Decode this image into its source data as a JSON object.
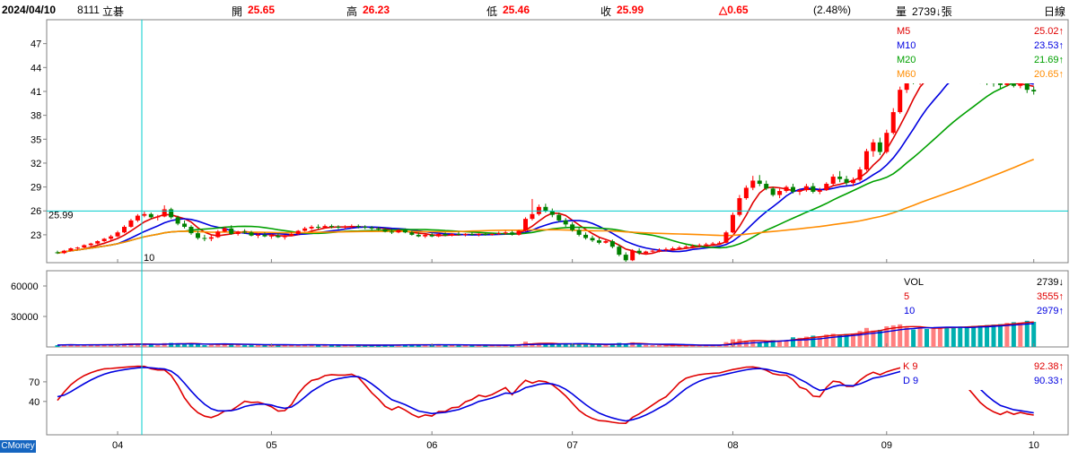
{
  "header": {
    "date": "2024/04/10",
    "code": "8111",
    "name": "立碁",
    "open_label": "開",
    "open": "25.65",
    "high_label": "高",
    "high": "26.23",
    "low_label": "低",
    "low": "25.46",
    "close_label": "收",
    "close": "25.99",
    "change": "△0.65",
    "change_pct": "(2.48%)",
    "volume_label": "量",
    "volume": "2739↓張",
    "period": "日線"
  },
  "colors": {
    "up": "#ff0000",
    "down": "#008000",
    "m5": "#e00000",
    "m10": "#0000e0",
    "m20": "#00a000",
    "m60": "#ff8c00",
    "crosshair": "#00cccc",
    "brand_bg": "#1565c0"
  },
  "brand": "CMoney",
  "chart_data": [
    {
      "type": "candlestick",
      "panel": "price",
      "yticks": [
        23,
        26,
        29,
        32,
        35,
        38,
        41,
        44,
        47
      ],
      "ylim": [
        19.5,
        50
      ],
      "crosshair_value": "25.99",
      "crosshair_tick": "10",
      "x_month_labels": [
        "04",
        "05",
        "06",
        "07",
        "08",
        "09",
        "10"
      ],
      "x_month_index": [
        9,
        32,
        56,
        77,
        101,
        124,
        146
      ],
      "legend": [
        {
          "name": "M5",
          "value": "25.02↑",
          "color": "#e00000"
        },
        {
          "name": "M10",
          "value": "23.53↑",
          "color": "#0000e0"
        },
        {
          "name": "M20",
          "value": "21.69↑",
          "color": "#00a000"
        },
        {
          "name": "M60",
          "value": "20.65↑",
          "color": "#ff8c00"
        }
      ],
      "ohlc": [
        [
          20.8,
          21.0,
          20.6,
          20.7
        ],
        [
          20.7,
          21.1,
          20.6,
          21.0
        ],
        [
          21.0,
          21.4,
          20.9,
          21.3
        ],
        [
          21.3,
          21.5,
          21.1,
          21.4
        ],
        [
          21.4,
          21.8,
          21.3,
          21.7
        ],
        [
          21.7,
          22.0,
          21.5,
          21.9
        ],
        [
          21.9,
          22.3,
          21.8,
          22.2
        ],
        [
          22.2,
          22.6,
          22.1,
          22.5
        ],
        [
          22.5,
          23.0,
          22.3,
          22.8
        ],
        [
          22.8,
          23.5,
          22.7,
          23.3
        ],
        [
          23.3,
          24.2,
          23.2,
          24.0
        ],
        [
          24.0,
          25.0,
          23.9,
          24.8
        ],
        [
          24.8,
          25.6,
          24.6,
          25.4
        ],
        [
          25.4,
          25.9,
          25.2,
          25.6
        ],
        [
          25.6,
          25.8,
          25.0,
          25.2
        ],
        [
          25.2,
          25.5,
          24.8,
          25.3
        ],
        [
          25.3,
          26.7,
          25.2,
          26.2
        ],
        [
          26.2,
          26.4,
          25.0,
          25.2
        ],
        [
          25.2,
          25.4,
          24.2,
          24.4
        ],
        [
          24.4,
          24.8,
          23.8,
          24.0
        ],
        [
          24.0,
          24.2,
          23.0,
          23.2
        ],
        [
          23.2,
          23.5,
          22.4,
          22.6
        ],
        [
          22.6,
          23.0,
          22.2,
          22.5
        ],
        [
          22.5,
          23.0,
          22.2,
          22.7
        ],
        [
          22.7,
          23.6,
          22.6,
          23.4
        ],
        [
          23.4,
          24.0,
          23.3,
          23.8
        ],
        [
          23.8,
          24.2,
          23.0,
          23.1
        ],
        [
          23.1,
          23.5,
          22.9,
          23.4
        ],
        [
          23.4,
          23.7,
          23.1,
          23.3
        ],
        [
          23.3,
          23.5,
          22.8,
          22.9
        ],
        [
          22.9,
          23.2,
          22.6,
          23.0
        ],
        [
          23.0,
          23.3,
          22.7,
          22.8
        ],
        [
          22.8,
          23.1,
          22.5,
          22.9
        ],
        [
          22.9,
          23.2,
          22.6,
          22.7
        ],
        [
          22.7,
          23.0,
          22.4,
          22.9
        ],
        [
          22.9,
          23.3,
          22.8,
          23.1
        ],
        [
          23.1,
          23.6,
          23.0,
          23.5
        ],
        [
          23.5,
          24.0,
          23.4,
          23.8
        ],
        [
          23.8,
          24.2,
          23.6,
          24.0
        ],
        [
          24.0,
          24.3,
          23.7,
          23.9
        ],
        [
          23.9,
          24.3,
          23.8,
          24.1
        ],
        [
          24.1,
          24.3,
          23.8,
          24.0
        ],
        [
          24.0,
          24.2,
          23.7,
          23.9
        ],
        [
          23.9,
          24.2,
          23.7,
          24.0
        ],
        [
          24.0,
          24.3,
          23.8,
          24.1
        ],
        [
          24.1,
          24.3,
          23.8,
          24.0
        ],
        [
          24.0,
          24.2,
          23.7,
          23.9
        ],
        [
          23.9,
          24.1,
          23.6,
          23.8
        ],
        [
          23.8,
          24.0,
          23.5,
          23.7
        ],
        [
          23.7,
          23.9,
          23.3,
          23.4
        ],
        [
          23.4,
          23.7,
          23.1,
          23.3
        ],
        [
          23.3,
          23.7,
          23.2,
          23.6
        ],
        [
          23.6,
          23.8,
          23.2,
          23.3
        ],
        [
          23.3,
          23.5,
          22.9,
          23.0
        ],
        [
          23.0,
          23.3,
          22.7,
          22.8
        ],
        [
          22.8,
          23.1,
          22.6,
          23.0
        ],
        [
          23.0,
          23.2,
          22.7,
          22.8
        ],
        [
          22.8,
          23.2,
          22.7,
          23.1
        ],
        [
          23.1,
          23.3,
          22.8,
          22.9
        ],
        [
          22.9,
          23.2,
          22.8,
          23.1
        ],
        [
          23.1,
          23.4,
          22.9,
          23.0
        ],
        [
          23.0,
          23.2,
          22.8,
          23.1
        ],
        [
          23.1,
          23.3,
          22.9,
          23.0
        ],
        [
          23.0,
          23.2,
          22.8,
          23.1
        ],
        [
          23.1,
          23.3,
          22.9,
          23.0
        ],
        [
          23.0,
          23.2,
          22.9,
          23.1
        ],
        [
          23.1,
          23.4,
          23.0,
          23.2
        ],
        [
          23.2,
          23.5,
          23.0,
          23.3
        ],
        [
          23.3,
          23.5,
          22.9,
          23.0
        ],
        [
          23.0,
          23.6,
          22.9,
          23.5
        ],
        [
          23.5,
          25.2,
          23.4,
          25.0
        ],
        [
          25.0,
          27.5,
          24.8,
          25.6
        ],
        [
          25.6,
          26.8,
          25.4,
          26.5
        ],
        [
          26.5,
          26.9,
          25.8,
          26.0
        ],
        [
          26.0,
          26.3,
          25.2,
          25.5
        ],
        [
          25.5,
          25.8,
          24.6,
          24.8
        ],
        [
          24.8,
          25.1,
          24.0,
          24.3
        ],
        [
          24.3,
          24.6,
          23.4,
          23.6
        ],
        [
          23.6,
          23.9,
          22.8,
          23.0
        ],
        [
          23.0,
          23.3,
          22.4,
          22.6
        ],
        [
          22.6,
          22.9,
          22.1,
          22.3
        ],
        [
          22.3,
          22.6,
          21.8,
          22.0
        ],
        [
          22.0,
          22.4,
          21.9,
          22.2
        ],
        [
          22.2,
          22.4,
          21.3,
          21.5
        ],
        [
          21.5,
          21.8,
          20.3,
          20.5
        ],
        [
          20.5,
          20.8,
          19.5,
          19.8
        ],
        [
          19.8,
          21.2,
          19.7,
          21.0
        ],
        [
          21.0,
          21.3,
          20.5,
          20.7
        ],
        [
          20.7,
          21.0,
          20.5,
          20.9
        ],
        [
          20.9,
          21.2,
          20.7,
          21.0
        ],
        [
          21.0,
          21.3,
          20.8,
          21.1
        ],
        [
          21.1,
          21.4,
          20.9,
          21.2
        ],
        [
          21.2,
          21.5,
          21.0,
          21.3
        ],
        [
          21.3,
          21.6,
          21.1,
          21.4
        ],
        [
          21.4,
          21.7,
          21.2,
          21.5
        ],
        [
          21.5,
          21.8,
          21.3,
          21.6
        ],
        [
          21.6,
          21.9,
          21.4,
          21.7
        ],
        [
          21.7,
          22.0,
          21.5,
          21.8
        ],
        [
          21.8,
          22.1,
          21.6,
          21.9
        ],
        [
          21.9,
          22.2,
          21.7,
          22.0
        ],
        [
          22.0,
          23.5,
          21.9,
          23.3
        ],
        [
          23.3,
          25.8,
          23.2,
          25.5
        ],
        [
          25.5,
          28.0,
          25.3,
          27.6
        ],
        [
          27.6,
          29.2,
          27.4,
          28.9
        ],
        [
          28.9,
          30.4,
          28.6,
          29.8
        ],
        [
          29.8,
          30.5,
          29.1,
          29.4
        ],
        [
          29.4,
          29.8,
          28.6,
          28.8
        ],
        [
          28.8,
          29.0,
          27.8,
          28.0
        ],
        [
          28.0,
          28.8,
          27.6,
          28.5
        ],
        [
          28.5,
          29.2,
          28.3,
          29.0
        ],
        [
          29.0,
          29.4,
          28.2,
          28.4
        ],
        [
          28.4,
          28.8,
          28.0,
          28.6
        ],
        [
          28.6,
          29.4,
          28.4,
          29.1
        ],
        [
          29.1,
          29.5,
          28.2,
          28.4
        ],
        [
          28.4,
          28.9,
          28.1,
          28.6
        ],
        [
          28.6,
          29.6,
          28.5,
          29.4
        ],
        [
          29.4,
          30.6,
          29.2,
          30.3
        ],
        [
          30.3,
          31.0,
          29.6,
          30.0
        ],
        [
          30.0,
          30.4,
          29.2,
          29.5
        ],
        [
          29.5,
          30.2,
          29.1,
          29.9
        ],
        [
          29.9,
          31.5,
          29.7,
          31.2
        ],
        [
          31.2,
          33.8,
          31.0,
          33.5
        ],
        [
          33.5,
          35.0,
          32.8,
          34.6
        ],
        [
          34.6,
          35.2,
          33.0,
          33.4
        ],
        [
          33.4,
          36.2,
          33.2,
          35.8
        ],
        [
          35.8,
          38.9,
          35.6,
          38.4
        ],
        [
          38.4,
          41.6,
          38.2,
          41.2
        ],
        [
          41.2,
          43.0,
          40.8,
          42.6
        ],
        [
          42.6,
          43.5,
          41.9,
          42.2
        ],
        [
          42.2,
          43.8,
          41.8,
          43.4
        ],
        [
          43.4,
          43.9,
          42.6,
          43.1
        ],
        [
          43.1,
          44.2,
          42.8,
          43.8
        ],
        [
          43.8,
          44.6,
          43.3,
          44.2
        ],
        [
          44.2,
          44.8,
          43.4,
          43.6
        ],
        [
          43.6,
          44.1,
          42.9,
          43.3
        ],
        [
          43.3,
          43.8,
          42.6,
          43.0
        ],
        [
          43.0,
          43.5,
          42.4,
          42.8
        ],
        [
          42.8,
          43.3,
          42.2,
          42.6
        ],
        [
          42.6,
          43.1,
          42.0,
          42.4
        ],
        [
          42.4,
          42.9,
          41.8,
          42.2
        ],
        [
          42.2,
          42.7,
          41.6,
          42.0
        ],
        [
          42.0,
          42.5,
          41.4,
          41.8
        ],
        [
          41.8,
          42.6,
          41.6,
          42.3
        ],
        [
          42.3,
          42.8,
          41.5,
          41.7
        ],
        [
          41.7,
          42.3,
          41.4,
          42.0
        ],
        [
          42.0,
          42.7,
          40.8,
          41.2
        ],
        [
          41.2,
          41.6,
          40.6,
          41.0
        ]
      ]
    },
    {
      "type": "bar",
      "panel": "volume",
      "yticks": [
        30000,
        60000
      ],
      "ylim": [
        0,
        75000
      ],
      "legend": [
        {
          "name": "VOL",
          "value": "2739↓",
          "color": "#000000"
        },
        {
          "name": "5",
          "value": "3555↑",
          "color": "#e00000"
        },
        {
          "name": "10",
          "value": "2979↑",
          "color": "#0000e0"
        }
      ]
    },
    {
      "type": "line",
      "panel": "kd",
      "yticks": [
        40,
        70
      ],
      "ylim": [
        0,
        100
      ],
      "legend": [
        {
          "name": "K 9",
          "value": "92.38↑",
          "color": "#e00000"
        },
        {
          "name": "D 9",
          "value": "90.33↑",
          "color": "#0000e0"
        }
      ]
    }
  ]
}
